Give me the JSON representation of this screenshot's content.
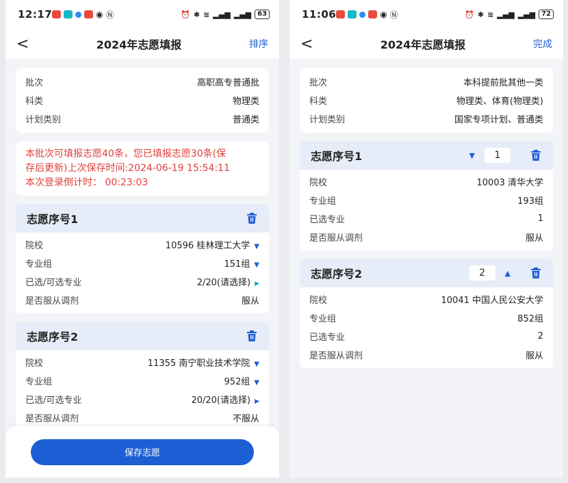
{
  "left": {
    "status": {
      "time": "12:17",
      "battery": "63"
    },
    "nav": {
      "back": "<",
      "title": "2024年志愿填报",
      "action": "排序"
    },
    "info": [
      {
        "label": "批次",
        "value": "高职高专普通批"
      },
      {
        "label": "科类",
        "value": "物理类"
      },
      {
        "label": "计划类别",
        "value": "普通类"
      }
    ],
    "notice": {
      "line1": "本批次可填报志愿40条，您已填报志愿30条(保",
      "line2": "存后更新)上次保存时间:2024-06-19 15:54:11",
      "line3": "本次登录倒计时：  00:23:03"
    },
    "volunteers": [
      {
        "title": "志愿序号1",
        "school_label": "院校",
        "school": "10596 桂林理工大学",
        "group_label": "专业组",
        "group": "151组",
        "major_label": "已选/可选专业",
        "major": "2/20(请选择)",
        "adjust_label": "是否服从调剂",
        "adjust": "服从"
      },
      {
        "title": "志愿序号2",
        "school_label": "院校",
        "school": "11355 南宁职业技术学院",
        "group_label": "专业组",
        "group": "952组",
        "major_label": "已选/可选专业",
        "major": "20/20(请选择)",
        "adjust_label": "是否服从调剂",
        "adjust": "不服从"
      }
    ],
    "save_label": "保存志愿"
  },
  "right": {
    "status": {
      "time": "11:06",
      "battery": "72"
    },
    "nav": {
      "back": "<",
      "title": "2024年志愿填报",
      "action": "完成"
    },
    "info": [
      {
        "label": "批次",
        "value": "本科提前批其他一类"
      },
      {
        "label": "科类",
        "value": "物理类、体育(物理类)"
      },
      {
        "label": "计划类别",
        "value": "国家专项计划、普通类"
      }
    ],
    "volunteers": [
      {
        "title": "志愿序号1",
        "order": "1",
        "school_label": "院校",
        "school": "10003 清华大学",
        "group_label": "专业组",
        "group": "193组",
        "major_label": "已选专业",
        "major": "1",
        "adjust_label": "是否服从调剂",
        "adjust": "服从"
      },
      {
        "title": "志愿序号2",
        "order": "2",
        "school_label": "院校",
        "school": "10041 中国人民公安大学",
        "group_label": "专业组",
        "group": "852组",
        "major_label": "已选专业",
        "major": "2",
        "adjust_label": "是否服从调剂",
        "adjust": "服从"
      }
    ]
  },
  "colors": {
    "accent": "#1e5fd6",
    "notice": "#e0403a",
    "teal": "#19a7b8",
    "card_head": "#e6edf8"
  },
  "icons": [
    "trash-icon",
    "caret-down-icon",
    "caret-up-icon",
    "arrow-right-icon",
    "back-icon"
  ]
}
